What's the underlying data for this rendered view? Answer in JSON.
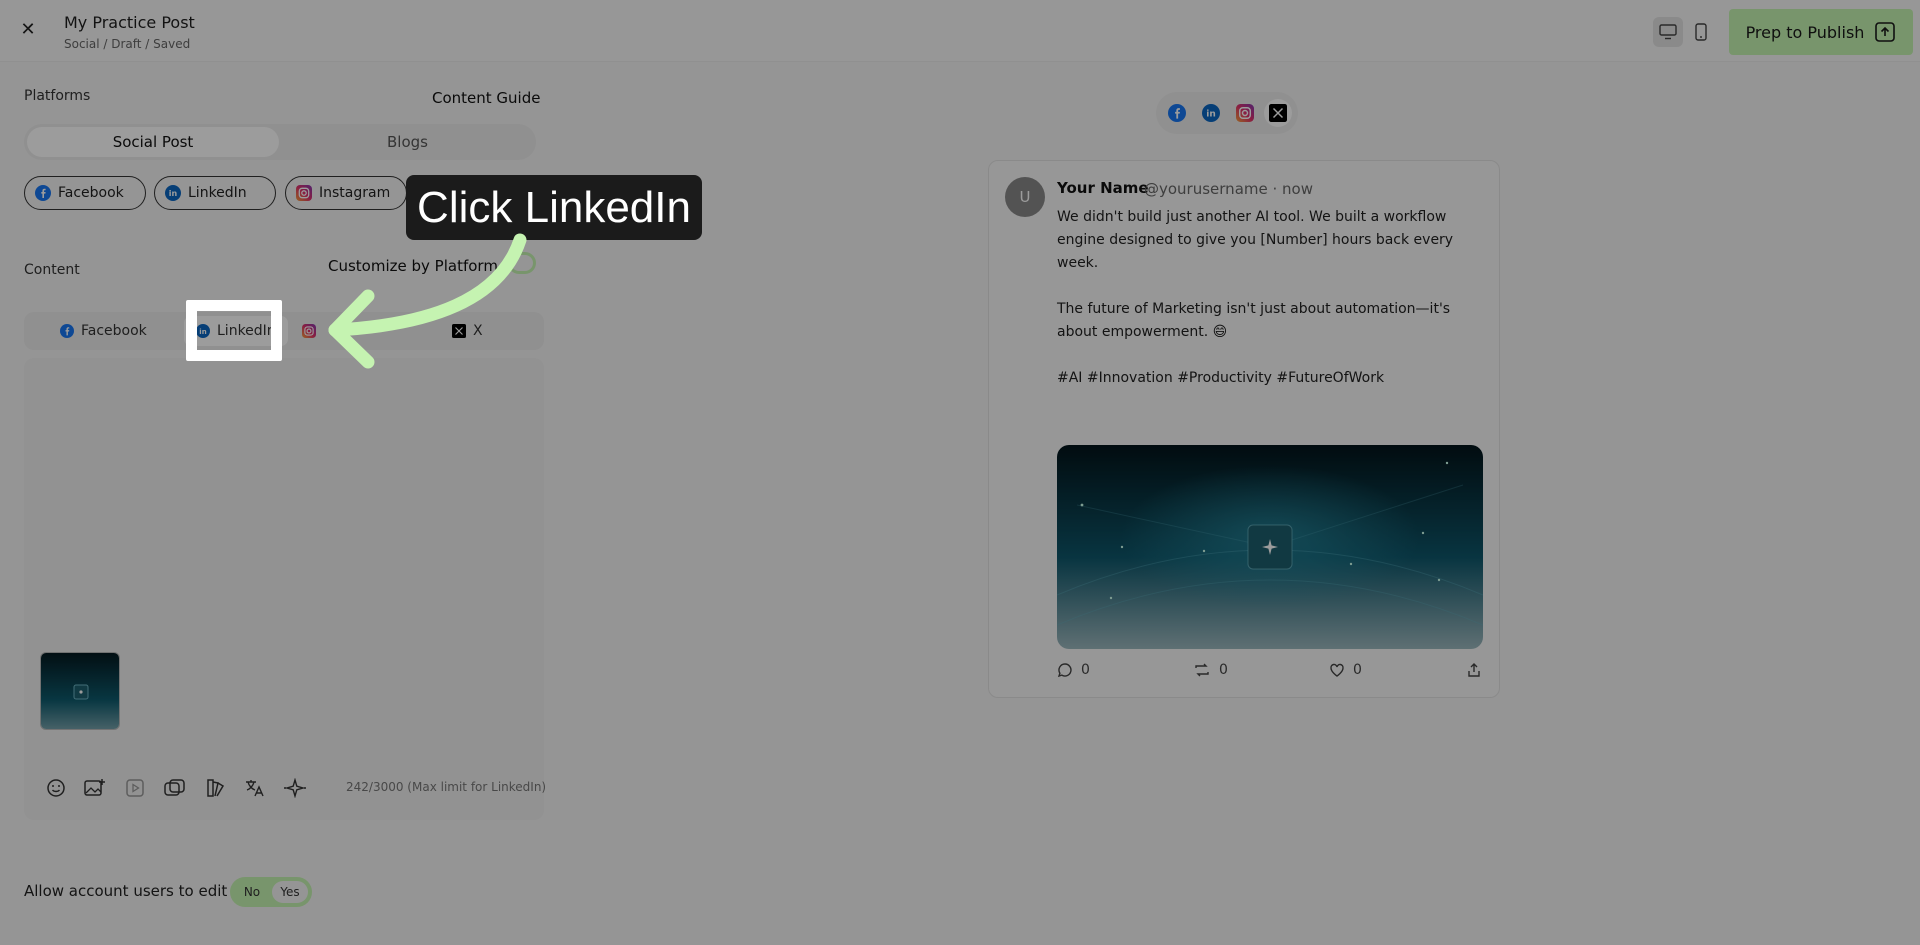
{
  "header": {
    "title": "My Practice Post",
    "breadcrumb": "Social / Draft / Saved",
    "publish_label": "Prep to Publish"
  },
  "left": {
    "platforms_label": "Platforms",
    "content_guide": "Content Guide",
    "segments": [
      "Social Post",
      "Blogs"
    ],
    "chips": [
      "Facebook",
      "LinkedIn",
      "Instagram"
    ],
    "content_label": "Content",
    "customize_label": "Customize by Platform",
    "platform_tabs": [
      "Facebook",
      "LinkedIn",
      "X"
    ],
    "char_count": "242/3000 (Max limit for LinkedIn)",
    "allow_label": "Allow account users to edit",
    "allow_no": "No",
    "allow_yes": "Yes"
  },
  "preview": {
    "avatar_letter": "U",
    "name": "Your Name",
    "handle": "@yourusername · now",
    "text": "We didn't build just another AI tool. We built a workflow engine designed to give you [Number] hours back every week.\n\nThe future of Marketing isn't just about automation—it's about empowerment. 😄\n\n#AI #Innovation #Productivity #FutureOfWork",
    "actions": {
      "comments": "0",
      "reposts": "0",
      "likes": "0"
    }
  },
  "overlay": {
    "callout": "Click LinkedIn"
  },
  "colors": {
    "accent_green": "#c5f3b1",
    "facebook": "#1877f2",
    "linkedin": "#0a66c2",
    "x": "#000000"
  }
}
